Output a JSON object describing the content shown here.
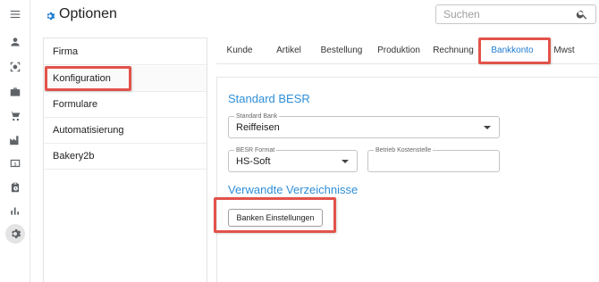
{
  "app": {
    "title": "Optionen",
    "title_icon": "gear-icon"
  },
  "search": {
    "placeholder": "Suchen",
    "icon": "search-icon"
  },
  "rail": {
    "items": [
      {
        "icon": "hamburger-menu-icon"
      },
      {
        "icon": "person-icon"
      },
      {
        "icon": "target-scan-icon"
      },
      {
        "icon": "briefcase-icon"
      },
      {
        "icon": "shopping-cart-icon"
      },
      {
        "icon": "factory-icon"
      },
      {
        "icon": "dollar-bill-icon"
      },
      {
        "icon": "clipboard-clock-icon"
      },
      {
        "icon": "bar-chart-icon"
      },
      {
        "icon": "gear-icon",
        "active": true
      }
    ]
  },
  "menu": {
    "items": [
      {
        "label": "Firma"
      },
      {
        "label": "Konfiguration",
        "selected": true
      },
      {
        "label": "Formulare"
      },
      {
        "label": "Automatisierung"
      },
      {
        "label": "Bakery2b"
      }
    ]
  },
  "tabs": [
    {
      "label": "Kunde"
    },
    {
      "label": "Artikel"
    },
    {
      "label": "Bestellung"
    },
    {
      "label": "Produktion"
    },
    {
      "label": "Rechnung"
    },
    {
      "label": "Bankkonto",
      "active": true
    },
    {
      "label": "Mwst"
    }
  ],
  "besr": {
    "title": "Standard BESR",
    "bank_label": "Standard Bank",
    "bank_value": "Reiffeisen",
    "format_label": "BESR Format",
    "format_value": "HS-Soft",
    "kostenstelle_label": "Betrieb Kostenstelle",
    "kostenstelle_value": ""
  },
  "verzeichnisse": {
    "title": "Verwandte Verzeichnisse",
    "button_label": "Banken Einstellungen"
  },
  "colors": {
    "accent": "#1e7bd0",
    "highlight": "#e2534a"
  }
}
